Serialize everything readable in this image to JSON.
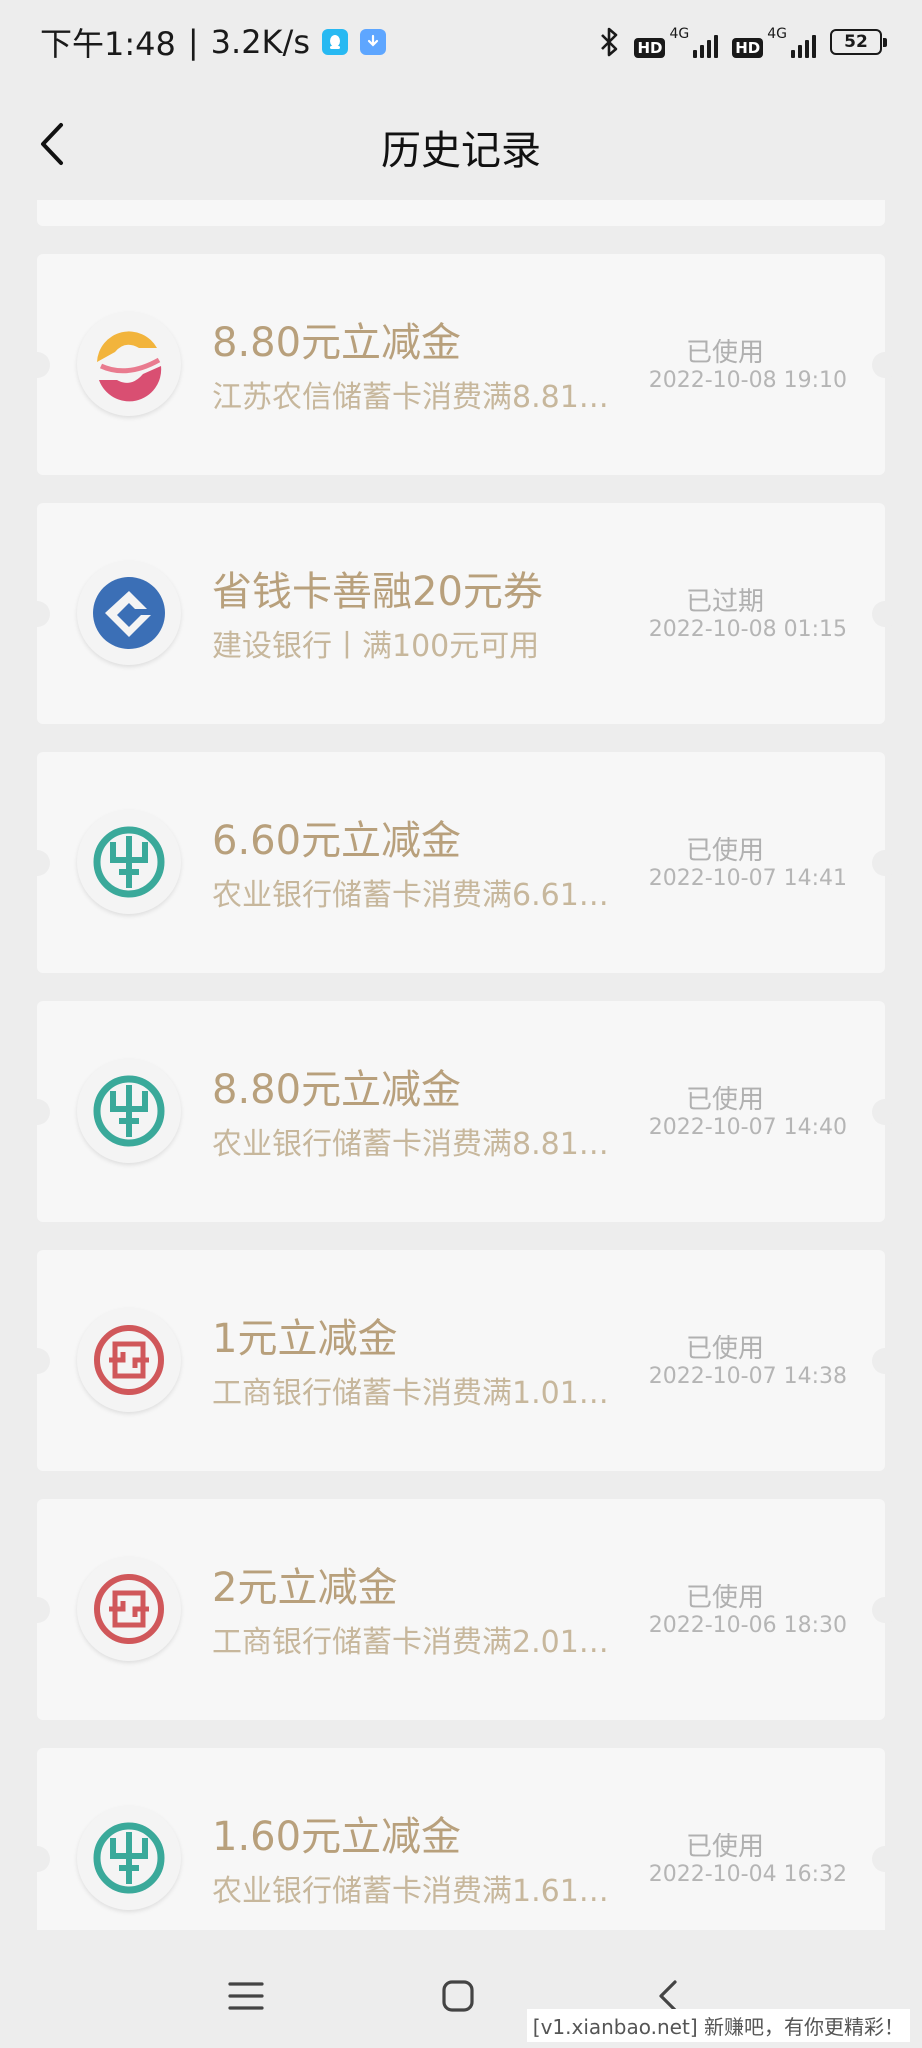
{
  "status_bar": {
    "time": "下午1:48",
    "separator": "|",
    "speed": "3.2K/s",
    "network_1": "4G",
    "network_2": "4G",
    "hd_1": "HD",
    "hd_2": "HD",
    "battery": "52"
  },
  "nav": {
    "title": "历史记录"
  },
  "records": [
    {
      "bank": "jiangsu-rural",
      "logo": "jiangsu-rural-bank-logo",
      "title": "8.80元立减金",
      "subtitle": "江苏农信储蓄卡消费满8.81…",
      "status": "已使用",
      "time": "2022-10-08 19:10"
    },
    {
      "bank": "ccb",
      "logo": "ccb-logo",
      "title": "省钱卡善融20元券",
      "subtitle": "建设银行丨满100元可用",
      "status": "已过期",
      "time": "2022-10-08 01:15"
    },
    {
      "bank": "abc",
      "logo": "abc-logo",
      "title": "6.60元立减金",
      "subtitle": "农业银行储蓄卡消费满6.61…",
      "status": "已使用",
      "time": "2022-10-07 14:41"
    },
    {
      "bank": "abc",
      "logo": "abc-logo",
      "title": "8.80元立减金",
      "subtitle": "农业银行储蓄卡消费满8.81…",
      "status": "已使用",
      "time": "2022-10-07 14:40"
    },
    {
      "bank": "icbc",
      "logo": "icbc-logo",
      "title": "1元立减金",
      "subtitle": "工商银行储蓄卡消费满1.01…",
      "status": "已使用",
      "time": "2022-10-07 14:38"
    },
    {
      "bank": "icbc",
      "logo": "icbc-logo",
      "title": "2元立减金",
      "subtitle": "工商银行储蓄卡消费满2.01…",
      "status": "已使用",
      "time": "2022-10-06 18:30"
    },
    {
      "bank": "abc",
      "logo": "abc-logo",
      "title": "1.60元立减金",
      "subtitle": "农业银行储蓄卡消费满1.61…",
      "status": "已使用",
      "time": "2022-10-04 16:32"
    }
  ],
  "colors": {
    "title": "#b8a07c",
    "subtitle": "#c7b79c",
    "abc_green": "#3aa99a",
    "ccb_blue": "#3b6fb6",
    "icbc_red": "#d0575a",
    "jiangsu_orange": "#f2b43c",
    "jiangsu_pink": "#d94f72"
  },
  "watermark": "[v1.xianbao.net] 新赚吧，有你更精彩！"
}
